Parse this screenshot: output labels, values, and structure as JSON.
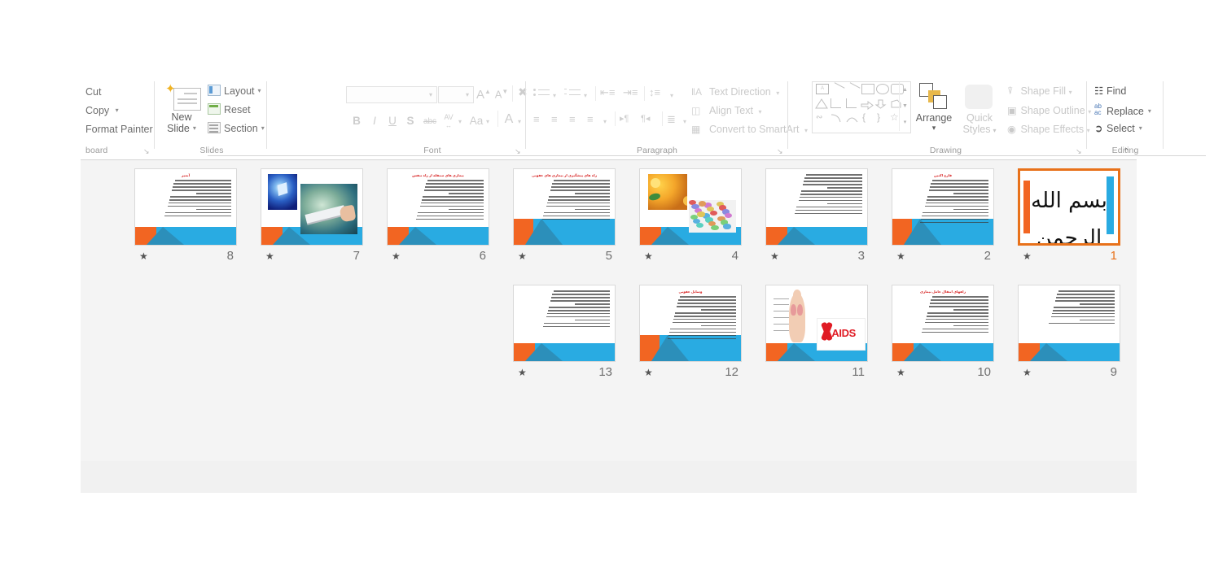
{
  "app": {
    "name": "PowerPoint Slide Sorter"
  },
  "ribbon": {
    "clipboard": {
      "group_label": "board",
      "items": [
        {
          "label": "Cut",
          "caret": ""
        },
        {
          "label": "Copy",
          "caret": "▾"
        },
        {
          "label": "Format Painter",
          "caret": ""
        }
      ],
      "dialog_launcher": "↘"
    },
    "slides": {
      "group_label": "Slides",
      "new_slide_label": "New\nSlide",
      "new_slide_label_line1": "New",
      "new_slide_label_line2": "Slide",
      "new_slide_caret": "▾",
      "buttons": [
        {
          "label": "Layout",
          "caret": "▾",
          "icon": "layout-icon"
        },
        {
          "label": "Reset",
          "caret": "",
          "icon": "reset-icon"
        },
        {
          "label": "Section",
          "caret": "▾",
          "icon": "section-icon"
        }
      ]
    },
    "font": {
      "group_label": "Font",
      "font_name_value": "",
      "font_name_placeholder": "",
      "font_size_value": "",
      "grow_font": "A",
      "shrink_font": "A",
      "clear_formatting": "clear-formatting-icon",
      "bold": "B",
      "italic": "I",
      "underline": "U",
      "shadow": "S",
      "strikethrough": "abc",
      "character_spacing": "AV",
      "change_case": "Aa",
      "font_color": "A",
      "dialog_launcher": "↘"
    },
    "paragraph": {
      "group_label": "Paragraph",
      "text_direction": "Text Direction",
      "align_text": "Align Text",
      "convert_to_smartart": "Convert to SmartArt",
      "bullets": "bullets-icon",
      "numbering": "numbering-icon",
      "decrease_indent": "decrease-indent-icon",
      "increase_indent": "increase-indent-icon",
      "line_spacing": "line-spacing-icon",
      "align_left": "align-left-icon",
      "align_center": "align-center-icon",
      "align_right": "align-right-icon",
      "justify": "justify-icon",
      "ltr": "▸¶",
      "rtl": "¶◂",
      "columns": "columns-icon",
      "dialog_launcher": "↘"
    },
    "drawing": {
      "group_label": "Drawing",
      "arrange_label": "Arrange",
      "arrange_caret": "▾",
      "quick_styles_line1": "Quick",
      "quick_styles_line2": "Styles",
      "quick_styles_caret": "▾",
      "shape_fill": "Shape Fill",
      "shape_outline": "Shape Outline",
      "shape_effects": "Shape Effects",
      "caret": "▾",
      "dialog_launcher": "↘"
    },
    "editing": {
      "group_label": "Editing",
      "find": "Find",
      "replace": "Replace",
      "select": "Select",
      "replace_caret": "▾",
      "select_caret": "▾",
      "collapse_ribbon": "⌃"
    }
  },
  "colors": {
    "accent_orange": "#f26522",
    "accent_blue": "#29abe2",
    "selection_border": "#e8711a",
    "title_red": "#d61f1f",
    "workspace_bg": "#f4f4f4"
  },
  "slides": [
    {
      "number": "8",
      "star": "★",
      "selected": false,
      "kind": "text",
      "title": "آنمیز",
      "lines": 12,
      "band": "short"
    },
    {
      "number": "7",
      "star": "★",
      "selected": false,
      "kind": "pictures-tech",
      "title": "",
      "lines": 0,
      "band": "short"
    },
    {
      "number": "6",
      "star": "★",
      "selected": false,
      "kind": "text",
      "title": "بیماری های منتقله از راه تنفس",
      "lines": 13,
      "band": "short"
    },
    {
      "number": "5",
      "star": "★",
      "selected": false,
      "kind": "text",
      "title": "راه های پیشگیری از بیماری های عفونی",
      "lines": 13,
      "band": "tall"
    },
    {
      "number": "4",
      "star": "★",
      "selected": false,
      "kind": "pictures-food",
      "title": "",
      "lines": 0,
      "band": "short"
    },
    {
      "number": "3",
      "star": "★",
      "selected": false,
      "kind": "text",
      "title": "",
      "lines": 13,
      "band": "short"
    },
    {
      "number": "2",
      "star": "★",
      "selected": false,
      "kind": "text",
      "title": "قارچ اكتین",
      "lines": 14,
      "band": "tall"
    },
    {
      "number": "1",
      "star": "★",
      "selected": true,
      "kind": "bismillah",
      "title": "بسم الله الرحمن الرحیم",
      "lines": 0,
      "band": "none"
    },
    {
      "number": "13",
      "star": "★",
      "selected": false,
      "kind": "text",
      "title": "",
      "lines": 12,
      "band": "short"
    },
    {
      "number": "12",
      "star": "★",
      "selected": false,
      "kind": "text",
      "title": "وسایل عفونی",
      "lines": 14,
      "band": "tall"
    },
    {
      "number": "11",
      "star": "",
      "selected": false,
      "kind": "pictures-aids",
      "title": "",
      "lines": 0,
      "band": "short",
      "aids_label": "AIDS"
    },
    {
      "number": "10",
      "star": "★",
      "selected": false,
      "kind": "text",
      "title": "راههای انتقال عامل بیماری",
      "lines": 12,
      "band": "short"
    },
    {
      "number": "9",
      "star": "★",
      "selected": false,
      "kind": "text",
      "title": "",
      "lines": 11,
      "band": "short"
    }
  ]
}
